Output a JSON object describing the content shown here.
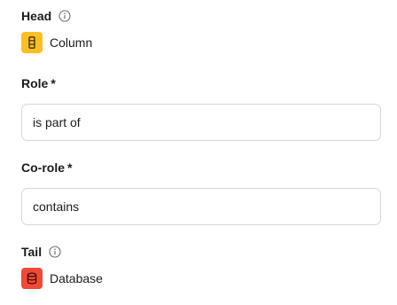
{
  "head": {
    "label": "Head",
    "type_icon": "column-icon",
    "value": "Column",
    "badge_color": "#fbbf24"
  },
  "role": {
    "label": "Role",
    "required_marker": "*",
    "value": "is part of"
  },
  "co_role": {
    "label": "Co-role",
    "required_marker": "*",
    "value": "contains"
  },
  "tail": {
    "label": "Tail",
    "type_icon": "database-icon",
    "value": "Database",
    "badge_color": "#f04a37"
  }
}
